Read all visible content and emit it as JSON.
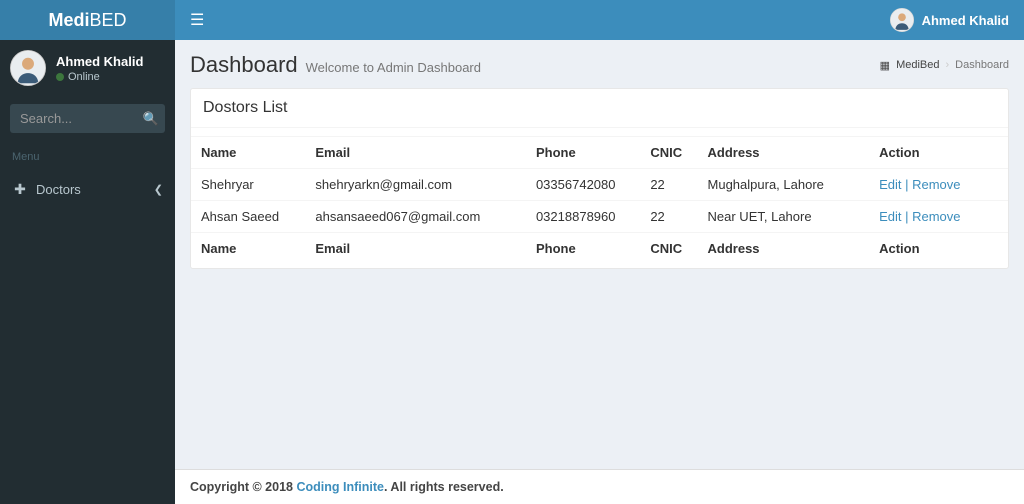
{
  "brand": {
    "prefix": "Medi",
    "suffix": "BED"
  },
  "header": {
    "username": "Ahmed Khalid"
  },
  "sidebar": {
    "user": {
      "name": "Ahmed Khalid",
      "status": "Online"
    },
    "search": {
      "placeholder": "Search..."
    },
    "menu_header": "Menu",
    "items": [
      {
        "icon": "medkit",
        "label": "Doctors"
      }
    ]
  },
  "page": {
    "title": "Dashboard",
    "subtitle": "Welcome to Admin Dashboard",
    "breadcrumb": {
      "home": "MediBed",
      "current": "Dashboard"
    }
  },
  "box": {
    "title": "Dostors List"
  },
  "table": {
    "columns": [
      "Name",
      "Email",
      "Phone",
      "CNIC",
      "Address",
      "Action"
    ],
    "rows": [
      {
        "name": "Shehryar",
        "email": "shehryarkn@gmail.com",
        "phone": "03356742080",
        "cnic": "22",
        "address": "Mughalpura, Lahore"
      },
      {
        "name": "Ahsan Saeed",
        "email": "ahsansaeed067@gmail.com",
        "phone": "03218878960",
        "cnic": "22",
        "address": "Near UET, Lahore"
      }
    ],
    "actions": {
      "edit": "Edit",
      "remove": "Remove"
    }
  },
  "footer": {
    "prefix": "Copyright © 2018 ",
    "link": "Coding Infinite",
    "suffix": ". All rights reserved."
  }
}
